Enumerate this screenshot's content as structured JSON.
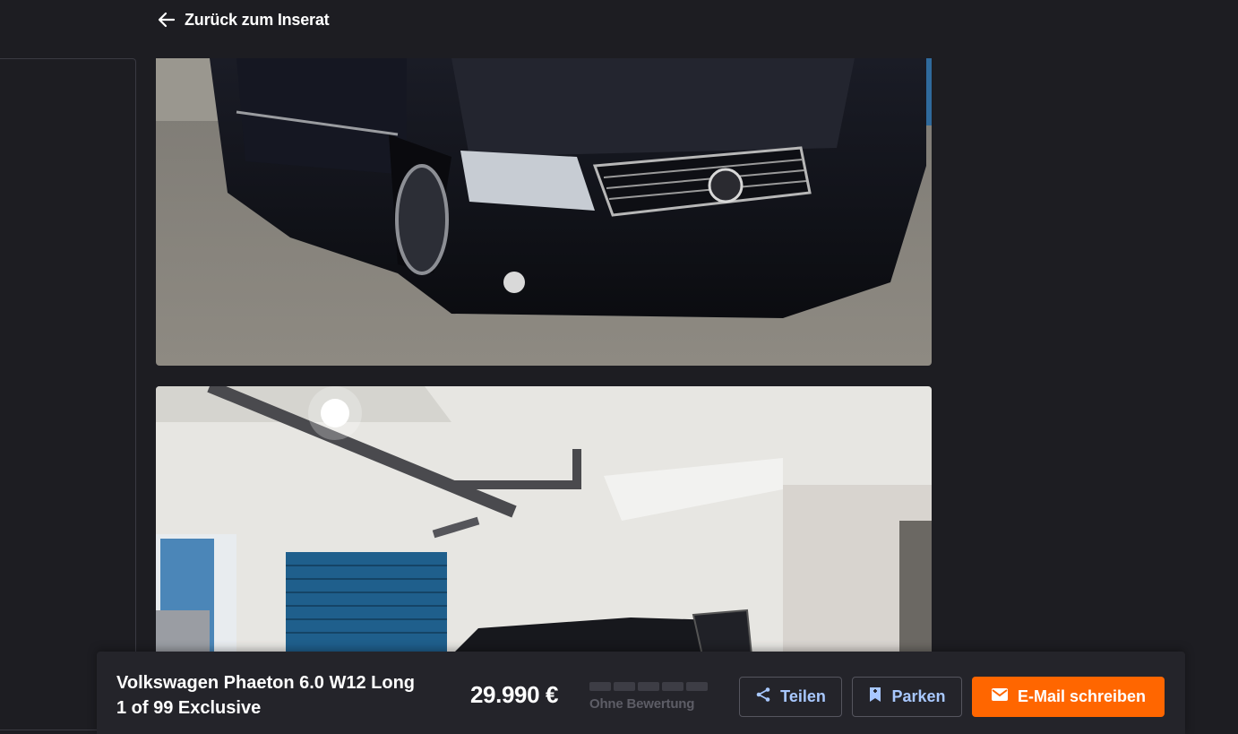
{
  "header": {
    "back_label": "Zurück zum Inserat"
  },
  "gallery": {
    "photos": [
      {
        "alt_icon": "car-front-photo"
      },
      {
        "alt_icon": "garage-photo"
      }
    ]
  },
  "listing": {
    "title_line1": "Volkswagen Phaeton 6.0 W12 Long",
    "title_line2": "1 of 99 Exclusive",
    "price": "29.990 €",
    "rating_label": "Ohne Bewertung",
    "rating_filled": 0,
    "rating_total": 5
  },
  "actions": {
    "share_label": "Teilen",
    "park_label": "Parken",
    "email_label": "E-Mail schreiben"
  },
  "colors": {
    "background": "#1d1d22",
    "bar": "#24242a",
    "accent": "#ff6600",
    "link": "#a8c8ff"
  }
}
